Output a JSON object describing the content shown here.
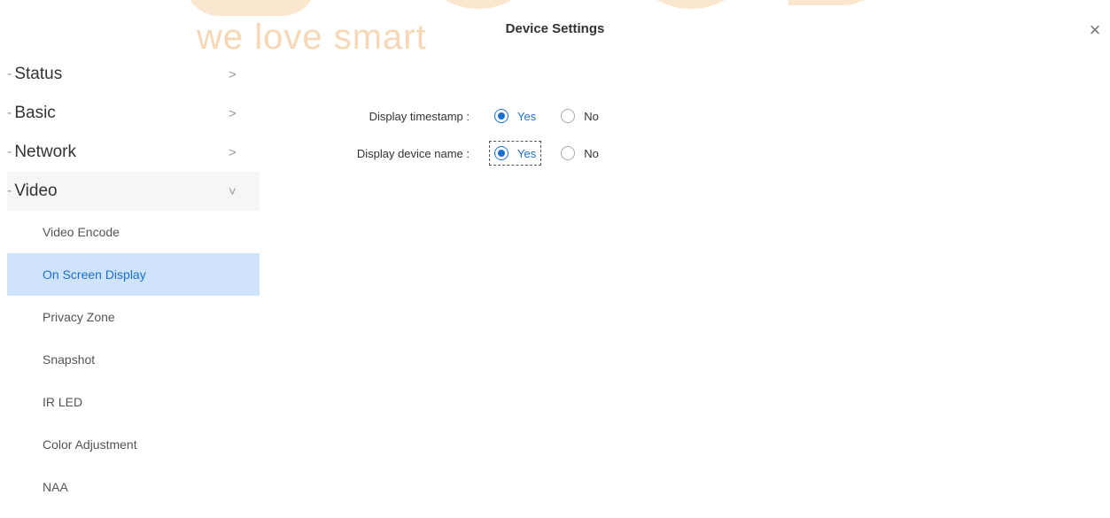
{
  "watermark": {
    "text": "we love smart"
  },
  "header": {
    "title": "Device Settings",
    "close_icon": "close-icon"
  },
  "sidebar": {
    "items": [
      {
        "label": "Status",
        "chevron": ">"
      },
      {
        "label": "Basic",
        "chevron": ">"
      },
      {
        "label": "Network",
        "chevron": ">"
      },
      {
        "label": "Video",
        "chevron": "˅"
      }
    ],
    "subitems": [
      {
        "label": "Video Encode"
      },
      {
        "label": "On Screen Display"
      },
      {
        "label": "Privacy Zone"
      },
      {
        "label": "Snapshot"
      },
      {
        "label": "IR LED"
      },
      {
        "label": "Color Adjustment"
      },
      {
        "label": "NAA"
      }
    ]
  },
  "form": {
    "timestamp": {
      "label": "Display timestamp :",
      "yes": "Yes",
      "no": "No",
      "selected": "Yes"
    },
    "device_name": {
      "label": "Display device name :",
      "yes": "Yes",
      "no": "No",
      "selected": "Yes"
    }
  },
  "colors": {
    "accent": "#1d6fd1",
    "active_bg": "#cfe3fa",
    "watermark": "#f6d7b6"
  }
}
